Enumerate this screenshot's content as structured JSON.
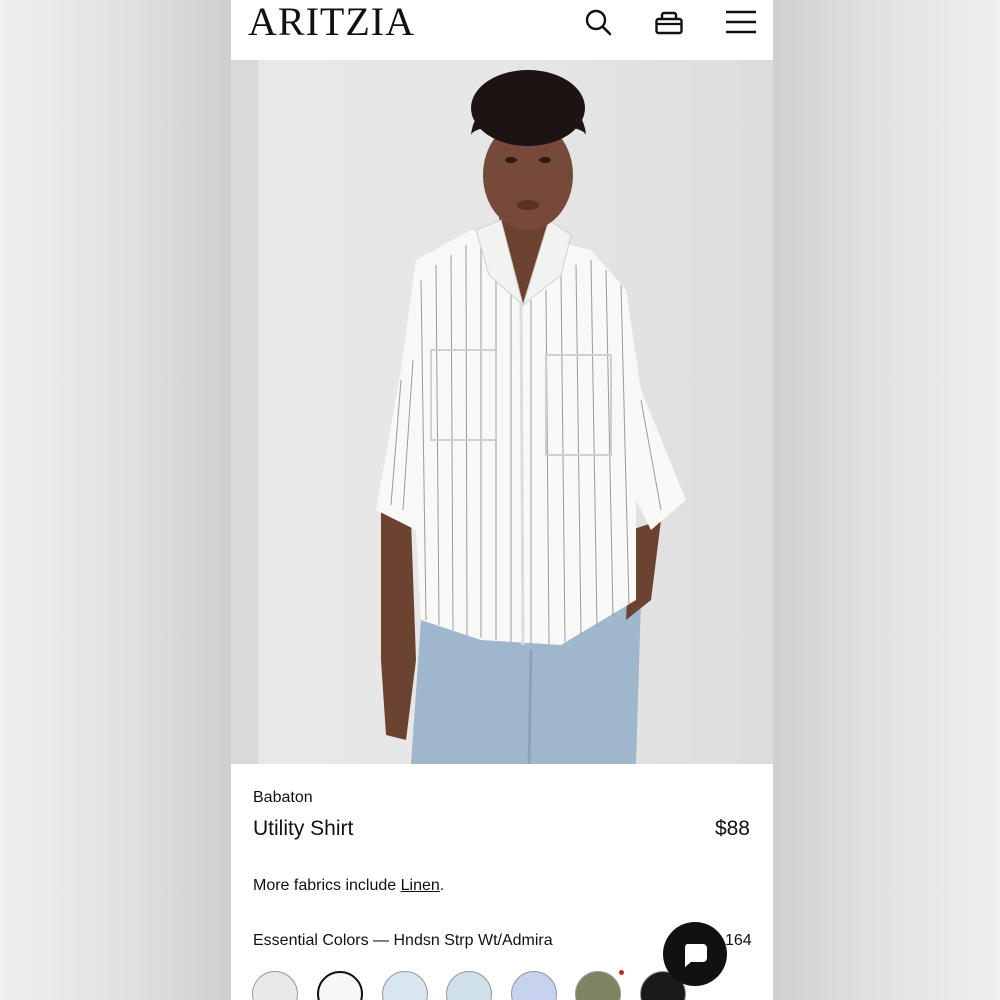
{
  "header": {
    "logo": "ARITZIA",
    "icons": [
      "search-icon",
      "bag-icon",
      "menu-icon"
    ]
  },
  "hero": {
    "image": "model-photo",
    "description_icon": "product-image"
  },
  "product": {
    "brand": "Babaton",
    "name": "Utility Shirt",
    "price": "$88",
    "fabrics_prefix": "More fabrics include ",
    "fabrics_link": "Linen",
    "fabrics_suffix": ".",
    "colors_label": "Essential Colors — Hndsn Strp Wt/Admira",
    "colors_count": "164"
  },
  "swatches": [
    {
      "name": "light-grey",
      "color": "#e9e9e9",
      "selected": false
    },
    {
      "name": "white",
      "color": "#f7f7f7",
      "selected": true
    },
    {
      "name": "pale-blue",
      "color": "#d7e6f1",
      "selected": false
    },
    {
      "name": "light-blue",
      "color": "#cfe0ea",
      "selected": false
    },
    {
      "name": "blue-stripe",
      "color": "#c7d2ee",
      "selected": false
    },
    {
      "name": "olive",
      "color": "#7d8461",
      "selected": false
    },
    {
      "name": "black",
      "color": "#1a1a1a",
      "selected": false
    }
  ],
  "chat": {
    "icon": "chat-icon"
  }
}
